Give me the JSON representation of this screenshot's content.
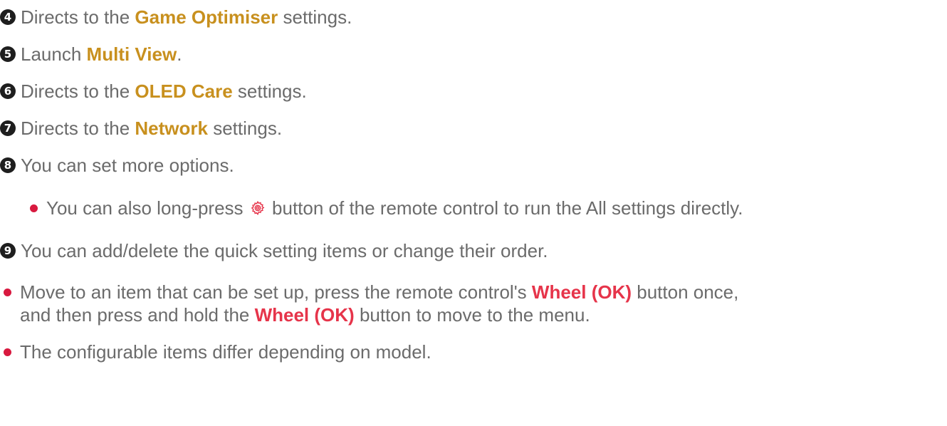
{
  "items": [
    {
      "number": "4",
      "before": "Directs to the",
      "term": "Game Optimiser",
      "after": "settings."
    },
    {
      "number": "5",
      "before": "Launch",
      "term": "Multi View",
      "after": "."
    },
    {
      "number": "6",
      "before": "Directs to the",
      "term": "OLED Care",
      "after": "settings."
    },
    {
      "number": "7",
      "before": "Directs to the",
      "term": "Network",
      "after": "settings."
    },
    {
      "number": "8",
      "text": "You can set more options."
    },
    {
      "number": "9",
      "text": "You can add/delete the quick setting items or change their order."
    }
  ],
  "sub_note": {
    "before": "You can also long-press",
    "icon": "gear-icon",
    "after": "button of the remote control to run the All settings directly."
  },
  "notes": [
    {
      "line1_before": "Move to an item that can be set up, press the remote control's",
      "line1_term": "Wheel (OK)",
      "line1_after": "button once,",
      "line2_before": "and then press and hold the",
      "line2_term": "Wheel (OK)",
      "line2_after": "button to move to the menu."
    },
    {
      "text": "The configurable items differ depending on model."
    }
  ],
  "colors": {
    "term_highlight": "#c8901e",
    "button_highlight": "#e6344a",
    "bullet": "#d8193f",
    "body_text": "#6b6b6b"
  }
}
